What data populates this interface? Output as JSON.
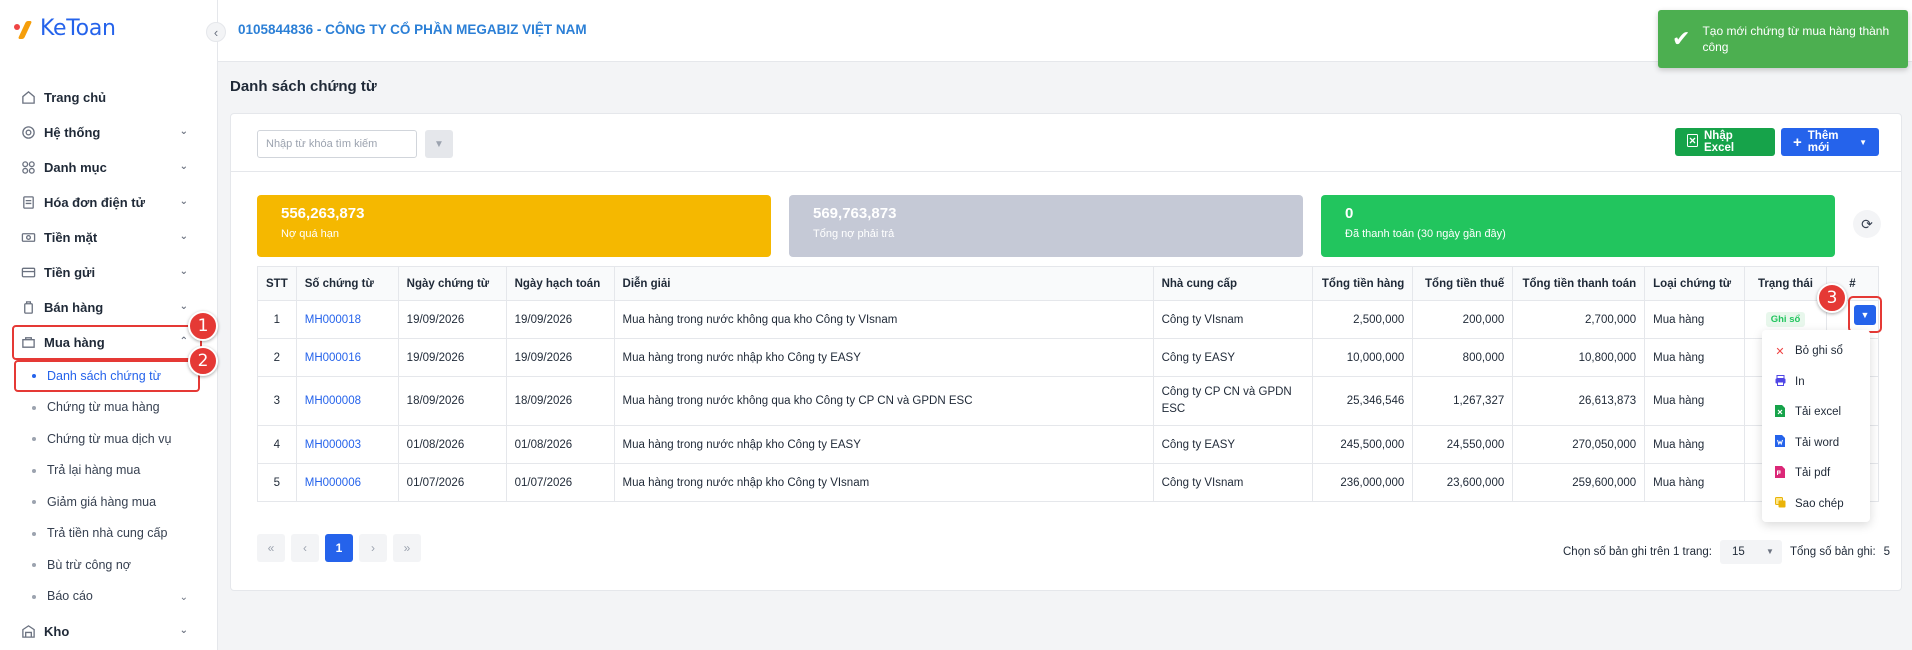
{
  "app": {
    "logo": "KeToan"
  },
  "header": {
    "company": "0105844836 - CÔNG TY CỔ PHẦN MEGABIZ VIỆT NAM"
  },
  "toast": {
    "message": "Tạo mới chứng từ mua hàng thành công"
  },
  "sidebar": {
    "items": [
      {
        "label": "Trang chủ",
        "icon": "home-icon"
      },
      {
        "label": "Hệ thống",
        "icon": "gear-icon"
      },
      {
        "label": "Danh mục",
        "icon": "grid-icon"
      },
      {
        "label": "Hóa đơn điện tử",
        "icon": "invoice-icon"
      },
      {
        "label": "Tiền mặt",
        "icon": "cash-icon"
      },
      {
        "label": "Tiền gửi",
        "icon": "card-icon"
      },
      {
        "label": "Bán hàng",
        "icon": "sales-icon"
      },
      {
        "label": "Mua hàng",
        "icon": "purchase-icon"
      }
    ],
    "purchase_sub": [
      "Danh sách chứng từ",
      "Chứng từ mua hàng",
      "Chứng từ mua dịch vụ",
      "Trả lại hàng mua",
      "Giảm giá hàng mua",
      "Trả tiền nhà cung cấp",
      "Bù trừ công nợ",
      "Báo cáo"
    ],
    "kho": {
      "label": "Kho",
      "icon": "warehouse-icon"
    }
  },
  "markers": [
    "1",
    "2",
    "3"
  ],
  "page": {
    "title": "Danh sách chứng từ"
  },
  "toolbar": {
    "search_placeholder": "Nhập từ khóa tìm kiếm",
    "import_excel": "Nhập Excel",
    "add_new": "Thêm mới"
  },
  "stats": [
    {
      "value": "556,263,873",
      "label": "Nợ quá hạn",
      "color": "#f5b800"
    },
    {
      "value": "569,763,873",
      "label": "Tổng nợ phải trả",
      "color": "#c5c9d6"
    },
    {
      "value": "0",
      "label": "Đã thanh toán (30 ngày gần đây)",
      "color": "#22c55e"
    }
  ],
  "table": {
    "headers": [
      "STT",
      "Số chứng từ",
      "Ngày chứng từ",
      "Ngày hạch toán",
      "Diễn giải",
      "Nhà cung cấp",
      "Tổng tiền hàng",
      "Tổng tiền thuế",
      "Tổng tiền thanh toán",
      "Loại chứng từ",
      "Trạng thái",
      "#"
    ],
    "rows": [
      {
        "stt": "1",
        "so": "MH000018",
        "ngay_ct": "19/09/2026",
        "ngay_ht": "19/09/2026",
        "dien_giai": "Mua hàng trong nước không qua kho Công ty VIsnam",
        "ncc": "Công ty VIsnam",
        "tien_hang": "2,500,000",
        "tien_thue": "200,000",
        "thanh_toan": "2,700,000",
        "loai": "Mua hàng",
        "trang_thai": "Ghi sổ"
      },
      {
        "stt": "2",
        "so": "MH000016",
        "ngay_ct": "19/09/2026",
        "ngay_ht": "19/09/2026",
        "dien_giai": "Mua hàng trong nước nhập kho Công ty EASY",
        "ncc": "Công ty EASY",
        "tien_hang": "10,000,000",
        "tien_thue": "800,000",
        "thanh_toan": "10,800,000",
        "loai": "Mua hàng",
        "trang_thai": ""
      },
      {
        "stt": "3",
        "so": "MH000008",
        "ngay_ct": "18/09/2026",
        "ngay_ht": "18/09/2026",
        "dien_giai": "Mua hàng trong nước không qua kho Công ty CP CN và GPDN ESC",
        "ncc": "Công ty CP CN và GPDN ESC",
        "tien_hang": "25,346,546",
        "tien_thue": "1,267,327",
        "thanh_toan": "26,613,873",
        "loai": "Mua hàng",
        "trang_thai": ""
      },
      {
        "stt": "4",
        "so": "MH000003",
        "ngay_ct": "01/08/2026",
        "ngay_ht": "01/08/2026",
        "dien_giai": "Mua hàng trong nước nhập kho Công ty EASY",
        "ncc": "Công ty EASY",
        "tien_hang": "245,500,000",
        "tien_thue": "24,550,000",
        "thanh_toan": "270,050,000",
        "loai": "Mua hàng",
        "trang_thai": ""
      },
      {
        "stt": "5",
        "so": "MH000006",
        "ngay_ct": "01/07/2026",
        "ngay_ht": "01/07/2026",
        "dien_giai": "Mua hàng trong nước nhập kho Công ty VIsnam",
        "ncc": "Công ty VIsnam",
        "tien_hang": "236,000,000",
        "tien_thue": "23,600,000",
        "thanh_toan": "259,600,000",
        "loai": "Mua hàng",
        "trang_thai": ""
      }
    ]
  },
  "dropdown": [
    {
      "label": "Bỏ ghi sổ",
      "icon": "close-icon",
      "color": "#ef4444"
    },
    {
      "label": "In",
      "icon": "printer-icon",
      "color": "#4f46e5"
    },
    {
      "label": "Tải excel",
      "icon": "excel-file-icon",
      "color": "#16a34a"
    },
    {
      "label": "Tải word",
      "icon": "word-file-icon",
      "color": "#2563eb"
    },
    {
      "label": "Tải pdf",
      "icon": "pdf-file-icon",
      "color": "#db2777"
    },
    {
      "label": "Sao chép",
      "icon": "copy-icon",
      "color": "#eab308"
    }
  ],
  "pagination": {
    "current": "1",
    "per_page_label": "Chọn số bản ghi trên 1 trang:",
    "per_page": "15",
    "total_label": "Tổng số bản ghi:",
    "total": "5"
  }
}
